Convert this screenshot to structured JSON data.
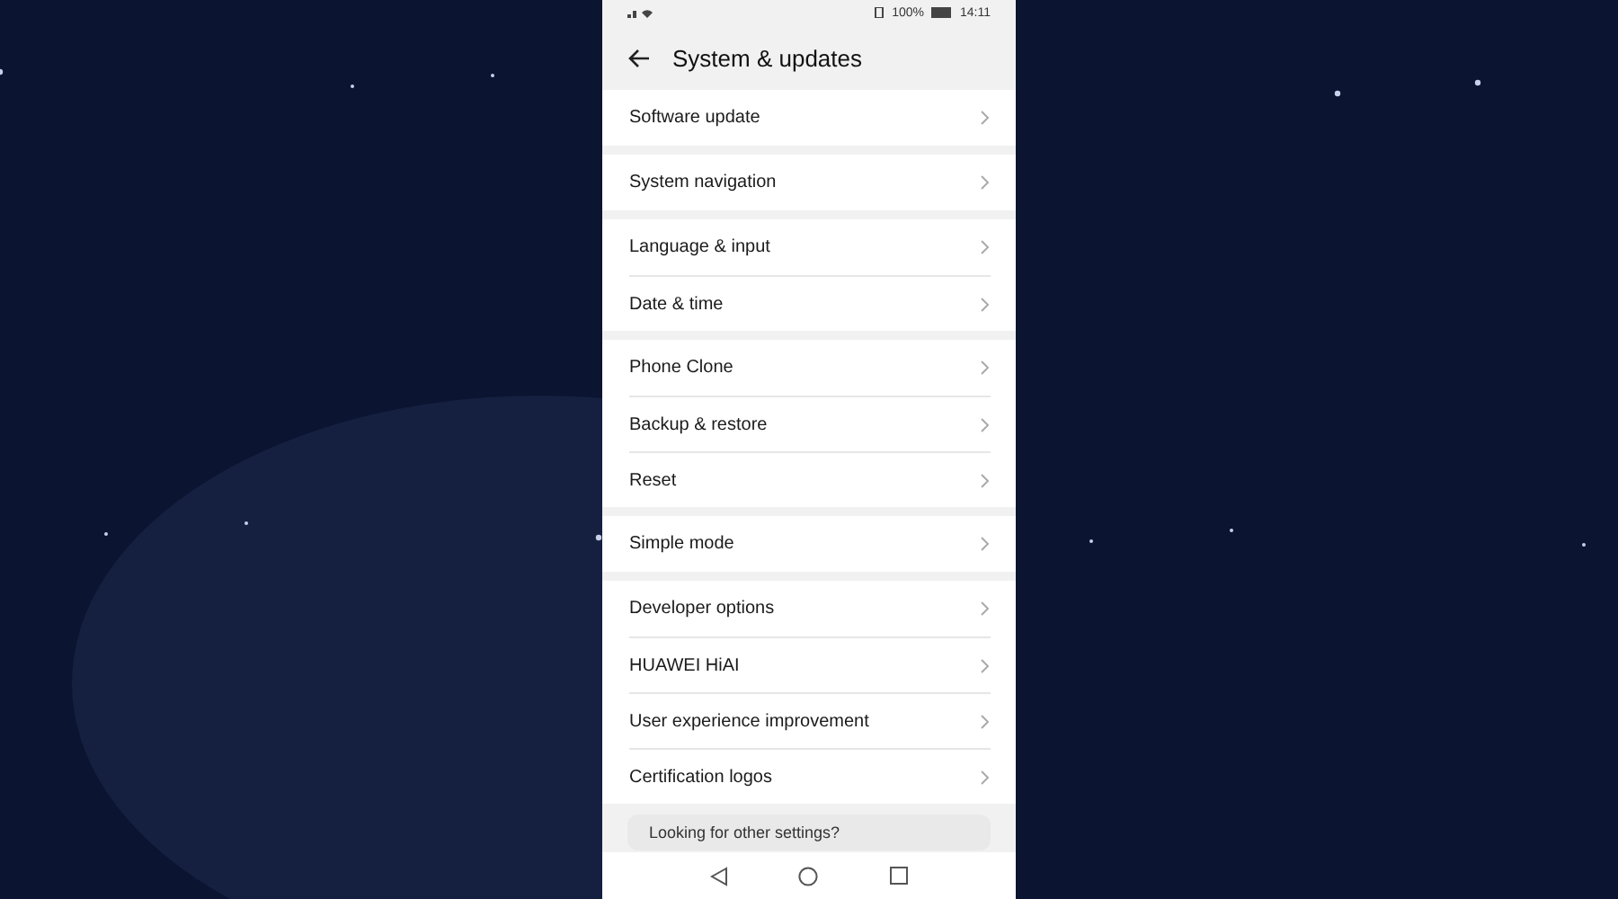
{
  "status_bar": {
    "battery": "100%",
    "time": "14:11"
  },
  "header": {
    "title": "System & updates"
  },
  "groups": [
    {
      "items": [
        "Software update"
      ]
    },
    {
      "items": [
        "System navigation"
      ]
    },
    {
      "items": [
        "Language & input",
        "Date & time"
      ]
    },
    {
      "items": [
        "Phone Clone",
        "Backup & restore",
        "Reset"
      ]
    },
    {
      "items": [
        "Simple mode"
      ]
    },
    {
      "items": [
        "Developer options",
        "HUAWEI HiAI",
        "User experience improvement",
        "Certification logos"
      ]
    }
  ],
  "suggestion": {
    "text": "Looking for other settings?"
  }
}
